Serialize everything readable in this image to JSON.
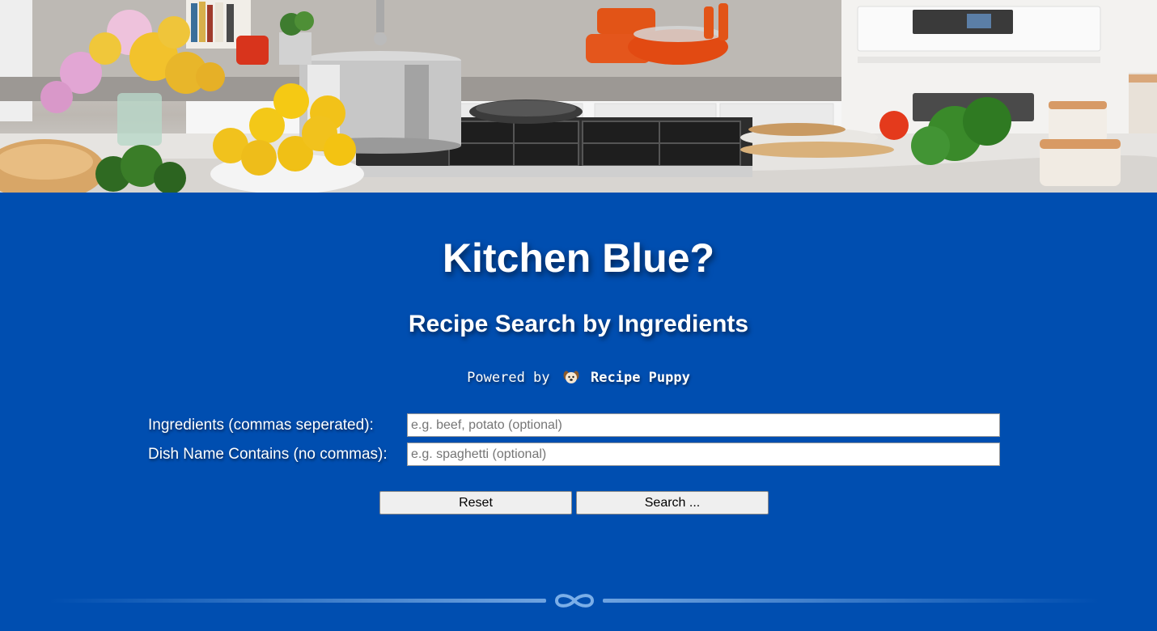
{
  "header": {
    "title": "Kitchen Blue?",
    "subtitle": "Recipe Search by Ingredients",
    "powered_prefix": "Powered by",
    "powered_brand": "Recipe Puppy"
  },
  "form": {
    "ingredients": {
      "label": "Ingredients (commas seperated):",
      "value": "",
      "placeholder": "e.g. beef, potato (optional)"
    },
    "dish_name": {
      "label": "Dish Name Contains (no commas):",
      "value": "",
      "placeholder": "e.g. spaghetti (optional)"
    }
  },
  "buttons": {
    "reset_label": "Reset",
    "search_label": "Search ..."
  },
  "icons": {
    "brand_icon": "puppy-icon",
    "divider_icon": "infinity-icon",
    "hero_image": "kitchen-photo"
  },
  "colors": {
    "background": "#004eb0",
    "text": "#ffffff",
    "button_bg": "#efefef"
  }
}
